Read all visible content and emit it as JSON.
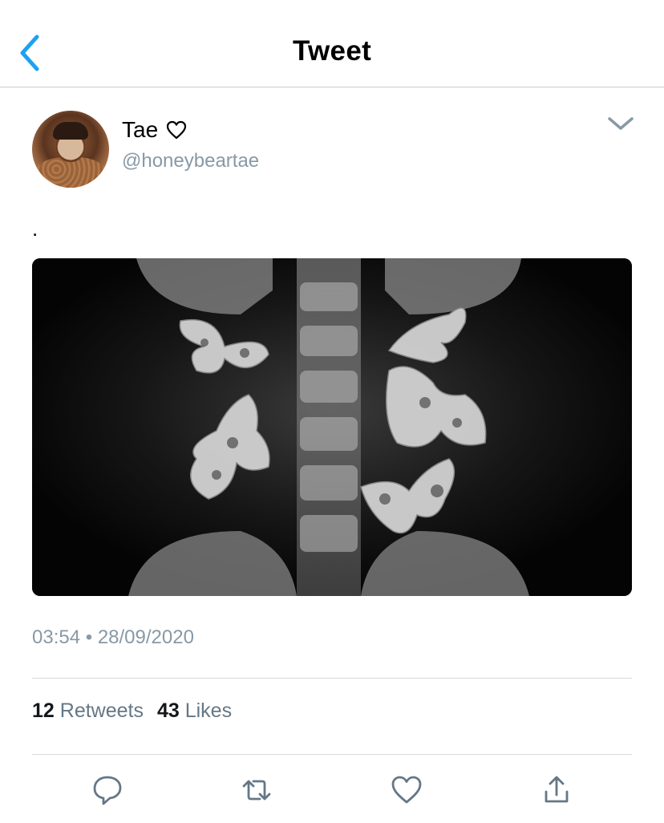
{
  "header": {
    "title": "Tweet",
    "back_icon": "chevron-left-icon"
  },
  "tweet": {
    "author": {
      "name": "Tae",
      "name_icon": "heart-outline-icon",
      "handle": "@honeybeartae"
    },
    "text": ".",
    "media": {
      "description_icon": "xray-butterflies-image"
    },
    "time": "03:54",
    "separator": "•",
    "date": "28/09/2020",
    "stats": {
      "retweets_count": "12",
      "retweets_label": "Retweets",
      "likes_count": "43",
      "likes_label": "Likes"
    },
    "actions": [
      "reply-icon",
      "retweet-icon",
      "like-icon",
      "share-icon"
    ]
  },
  "colors": {
    "accent": "#1da1f2",
    "muted": "#8899a6",
    "action_icon": "#657786"
  }
}
